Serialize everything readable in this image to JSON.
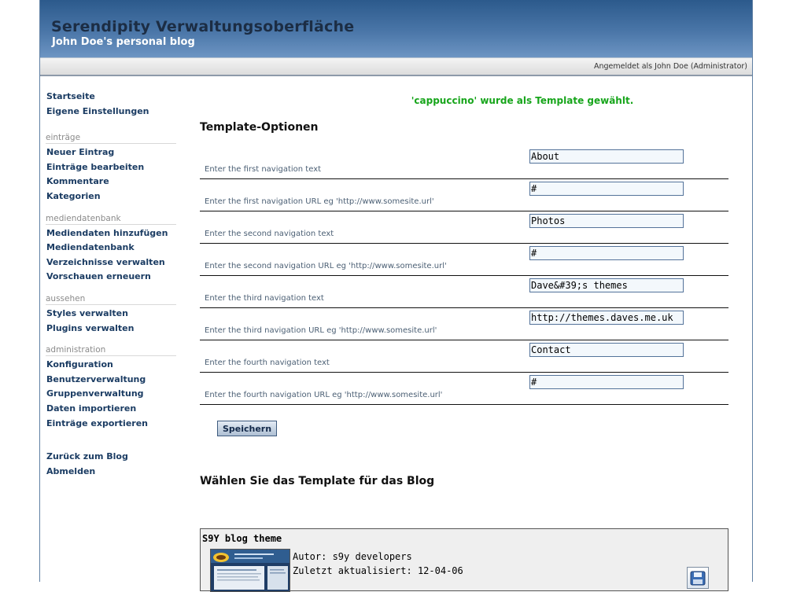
{
  "header": {
    "title": "Serendipity Verwaltungsoberfläche",
    "subtitle": "John Doe's personal blog"
  },
  "userbar": {
    "login_text": "Angemeldet als John Doe (Administrator)"
  },
  "sidebar": {
    "top_links": [
      "Startseite",
      "Eigene Einstellungen"
    ],
    "sections": [
      {
        "title": "einträge",
        "items": [
          "Neuer Eintrag",
          "Einträge bearbeiten",
          "Kommentare",
          "Kategorien"
        ]
      },
      {
        "title": "mediendatenbank",
        "items": [
          "Mediendaten hinzufügen",
          "Mediendatenbank",
          "Verzeichnisse verwalten",
          "Vorschauen erneuern"
        ]
      },
      {
        "title": "aussehen",
        "items": [
          "Styles verwalten",
          "Plugins verwalten"
        ]
      },
      {
        "title": "administration",
        "items": [
          "Konfiguration",
          "Benutzerverwaltung",
          "Gruppenverwaltung",
          "Daten importieren",
          "Einträge exportieren"
        ]
      }
    ],
    "bottom_links": [
      "Zurück zum Blog",
      "Abmelden"
    ]
  },
  "main": {
    "success_message": "'cappuccino' wurde als Template gewählt.",
    "options_heading": "Template-Optionen",
    "options": [
      {
        "label": "Enter the first navigation text",
        "value": "About"
      },
      {
        "label": "Enter the first navigation URL eg 'http://www.somesite.url'",
        "value": "#"
      },
      {
        "label": "Enter the second navigation text",
        "value": "Photos"
      },
      {
        "label": "Enter the second navigation URL eg 'http://www.somesite.url'",
        "value": "#"
      },
      {
        "label": "Enter the third navigation text",
        "value": "Dave&#39;s themes"
      },
      {
        "label": "Enter the third navigation URL eg 'http://www.somesite.url'",
        "value": "http://themes.daves.me.uk"
      },
      {
        "label": "Enter the fourth navigation text",
        "value": "Contact"
      },
      {
        "label": "Enter the fourth navigation URL eg 'http://www.somesite.url'",
        "value": "#"
      }
    ],
    "save_label": "Speichern",
    "choose_heading": "Wählen Sie das Template für das Blog",
    "theme": {
      "name": "S9Y blog theme",
      "author": "Autor: s9y developers",
      "updated": "Zuletzt aktualisiert: 12-04-06"
    }
  },
  "icons": {
    "theme_action": "save-disk-icon"
  }
}
